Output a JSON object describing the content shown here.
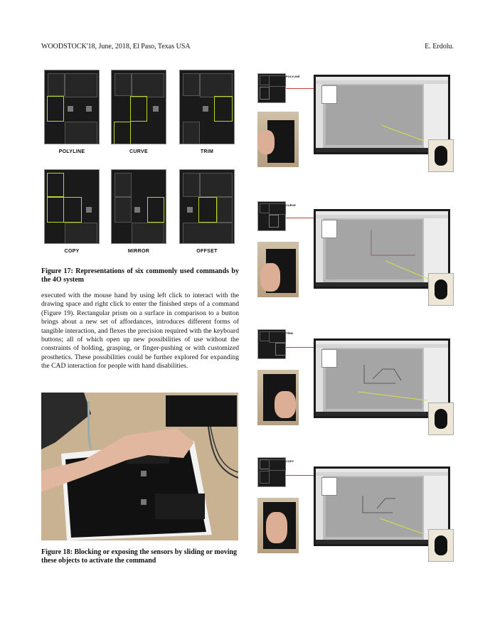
{
  "header": {
    "left": "WOODSTOCK'18, June, 2018, El Paso, Texas USA",
    "right": "E. Erdolu."
  },
  "figure17": {
    "panels": [
      "POLYLINE",
      "CURVE",
      "TRIM",
      "COPY",
      "MIRROR",
      "OFFSET"
    ],
    "caption": "Figure 17: Representations of six commonly used commands by the 4O system"
  },
  "body_text": "executed with the mouse hand by using left click to interact with the drawing space and right click to enter the finished steps of a command (Figure 19). Rectangular prism on a surface in comparison to a button brings about a new set of affordances, introduces different forms of tangible interaction, and flexes the precision required with the keyboard buttons; all of which open up new possibilities of use without the constraints of holding, grasping, or finger-pushing or with customized prosthetics. These possibilities could be further explored for expanding the CAD interaction for people with hand disabilities.",
  "figure18": {
    "caption": "Figure 18: Blocking or exposing the sensors by sliding or moving these objects to activate the command"
  },
  "figure19_rows": [
    "POLYLINE",
    "CURVE",
    "TRIM",
    "COPY"
  ],
  "colors": {
    "highlight": "#b8d62a",
    "connector": "#c24040",
    "cad_line": "#d6e04a"
  }
}
